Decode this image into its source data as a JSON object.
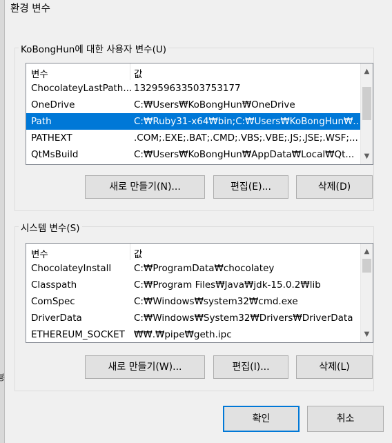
{
  "window": {
    "title": "환경 변수"
  },
  "left_fragment": "뵹",
  "user_section": {
    "label": "KoBongHun에 대한 사용자 변수(U)",
    "headers": {
      "variable": "변수",
      "value": "값"
    },
    "rows": [
      {
        "variable": "ChocolateyLastPath...",
        "value": "132959633503753177"
      },
      {
        "variable": "OneDrive",
        "value": "C:₩Users₩KoBongHun₩OneDrive"
      },
      {
        "variable": "Path",
        "value": "C:₩Ruby31-x64₩bin;C:₩Users₩KoBongHun₩...",
        "selected": true
      },
      {
        "variable": "PATHEXT",
        "value": ".COM;.EXE;.BAT;.CMD;.VBS;.VBE;.JS;.JSE;.WSF;..."
      },
      {
        "variable": "QtMsBuild",
        "value": "C:₩Users₩KoBongHun₩AppData₩Local₩Qt..."
      }
    ],
    "buttons": {
      "new": "새로 만들기(N)...",
      "edit": "편집(E)...",
      "delete": "삭제(D)"
    }
  },
  "system_section": {
    "label": "시스템 변수(S)",
    "headers": {
      "variable": "변수",
      "value": "값"
    },
    "rows": [
      {
        "variable": "ChocolateyInstall",
        "value": "C:₩ProgramData₩chocolatey"
      },
      {
        "variable": "Classpath",
        "value": "C:₩Program Files₩Java₩jdk-15.0.2₩lib"
      },
      {
        "variable": "ComSpec",
        "value": "C:₩Windows₩system32₩cmd.exe"
      },
      {
        "variable": "DriverData",
        "value": "C:₩Windows₩System32₩Drivers₩DriverData"
      },
      {
        "variable": "ETHEREUM_SOCKET",
        "value": "₩₩.₩pipe₩geth.ipc"
      }
    ],
    "buttons": {
      "new": "새로 만들기(W)...",
      "edit": "편집(I)...",
      "delete": "삭제(L)"
    }
  },
  "footer": {
    "ok": "확인",
    "cancel": "취소"
  }
}
